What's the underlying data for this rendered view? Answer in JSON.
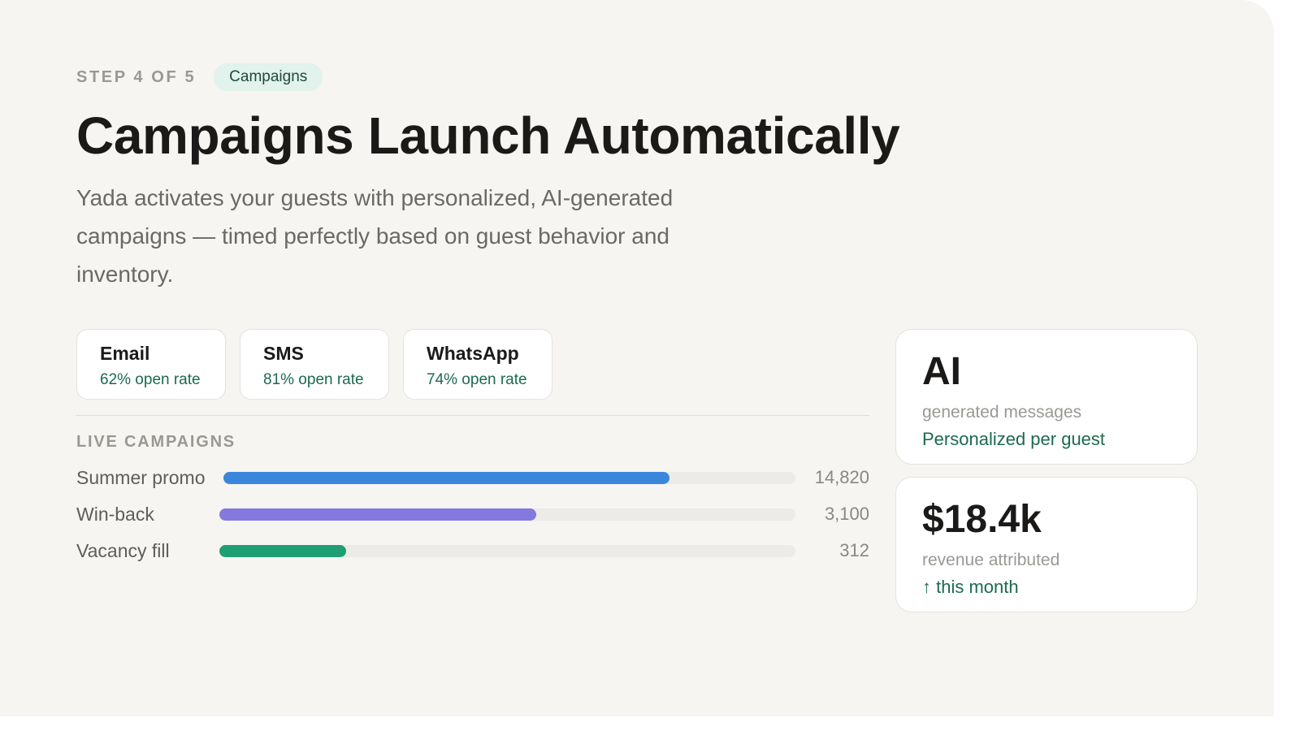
{
  "header": {
    "step_label": "STEP 4 OF 5",
    "tag": "Campaigns",
    "title": "Campaigns Launch Automatically",
    "subtitle": "Yada activates your guests with personalized, AI-generated campaigns — timed perfectly based on guest behavior and inventory."
  },
  "channels": [
    {
      "name": "Email",
      "rate": "62% open rate"
    },
    {
      "name": "SMS",
      "rate": "81% open rate"
    },
    {
      "name": "WhatsApp",
      "rate": "74% open rate"
    }
  ],
  "live_campaigns": {
    "label": "LIVE CAMPAIGNS",
    "items": [
      {
        "name": "Summer promo",
        "value": "14,820",
        "progress": 0.78,
        "color": "#3a86db"
      },
      {
        "name": "Win-back",
        "value": "3,100",
        "progress": 0.55,
        "color": "#8478de"
      },
      {
        "name": "Vacancy fill",
        "value": "312",
        "progress": 0.22,
        "color": "#1f9e74"
      }
    ]
  },
  "stats": [
    {
      "big": "AI",
      "sub": "generated messages",
      "accent": "Personalized per guest"
    },
    {
      "big": "$18.4k",
      "sub": "revenue attributed",
      "accent": "↑ this month"
    }
  ]
}
